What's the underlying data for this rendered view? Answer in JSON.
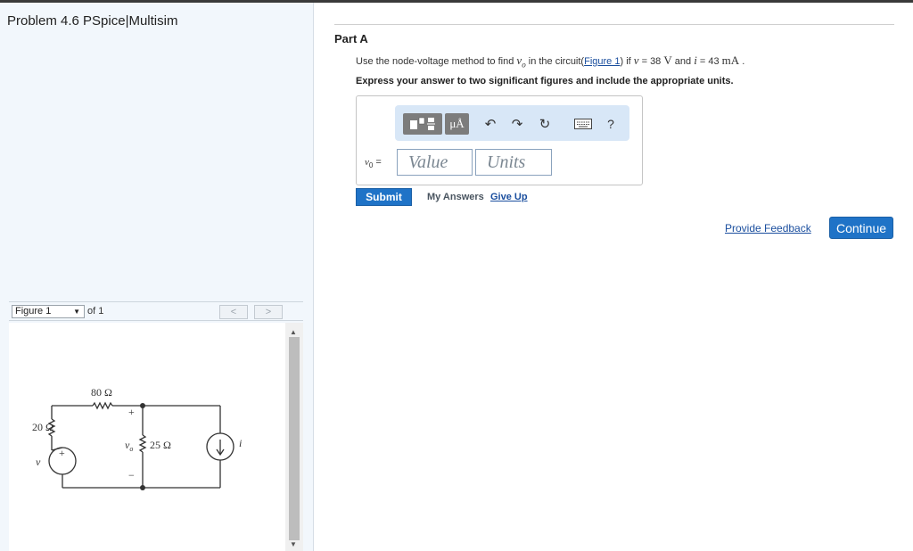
{
  "left": {
    "problem_title": "Problem 4.6 PSpice|Multisim",
    "figure_select": "Figure 1",
    "figure_of": "of 1",
    "circuit": {
      "r_top": "80 Ω",
      "r_left": "20 Ω",
      "r_mid": "25 Ω",
      "voltage_source": "v",
      "current_source": "i",
      "vo_label": "v",
      "vo_sub": "o",
      "plus": "+",
      "minus": "−"
    }
  },
  "right": {
    "part_title": "Part A",
    "question": {
      "pre": "Use the node-voltage method to find ",
      "vo": "v",
      "vo_sub": "o",
      "mid1": " in the circuit(",
      "link": "Figure 1",
      "mid2": ") if ",
      "v_var": "v",
      "v_eq": " = 38 ",
      "v_unit": "V",
      "and": " and ",
      "i_var": "i",
      "i_eq": " = 43 ",
      "i_unit": "mA",
      "end": " ."
    },
    "instruction": "Express your answer to two significant figures and include the appropriate units.",
    "toolbar": {
      "units_label": "μÅ",
      "undo_glyph": "↶",
      "redo_glyph": "↷",
      "reset_glyph": "↻",
      "help_glyph": "?"
    },
    "var_label": "v",
    "var_sub": "0",
    "var_eq": " =",
    "value_placeholder": "Value",
    "units_placeholder": "Units",
    "submit_label": "Submit",
    "my_answers": "My Answers",
    "give_up": "Give Up",
    "feedback": "Provide Feedback",
    "continue_label": "Continue"
  },
  "icons": {
    "templates": "templates-icon",
    "units": "units-icon",
    "undo": "undo-icon",
    "redo": "redo-icon",
    "reset": "reset-icon",
    "keyboard": "keyboard-icon",
    "help": "help-icon"
  },
  "colors": {
    "accent": "#1f73c7",
    "link": "#1a4e9e",
    "toolbar_bg": "#d8e7f7",
    "left_panel_bg": "#f2f7fc"
  }
}
